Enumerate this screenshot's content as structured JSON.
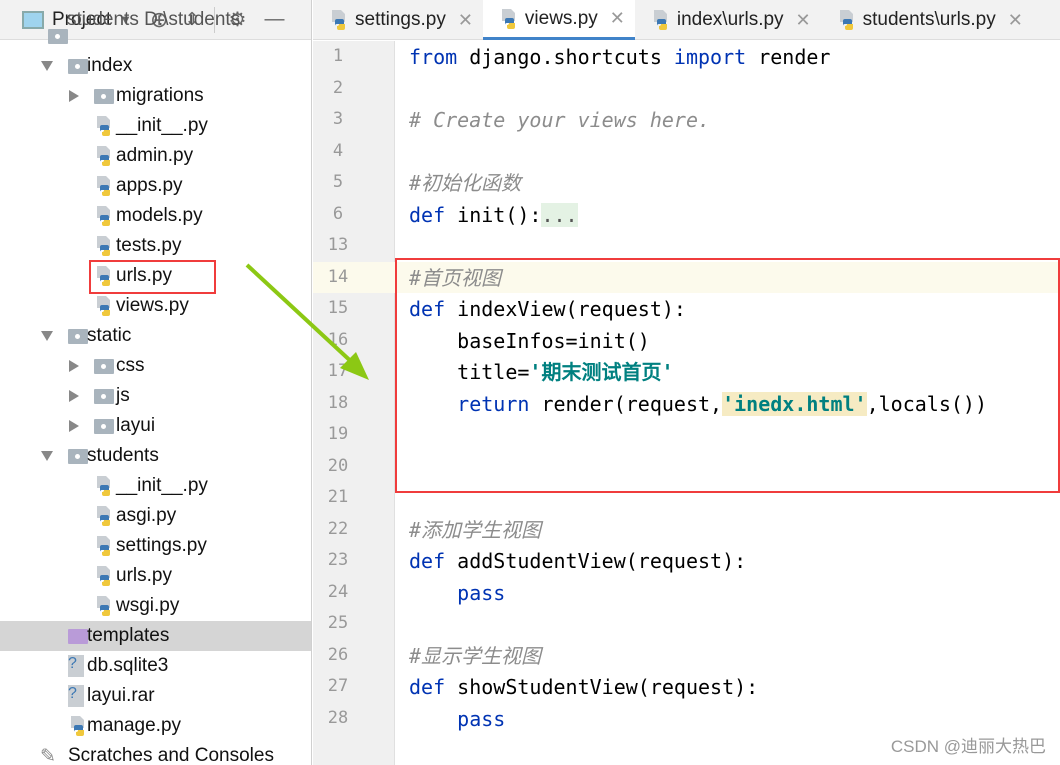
{
  "project_panel": {
    "title": "Project",
    "tree": [
      {
        "label": "students D:\\students",
        "level": 0,
        "type": "folder",
        "cut": true
      },
      {
        "label": "index",
        "level": 1,
        "type": "folder",
        "expanded": true
      },
      {
        "label": "migrations",
        "level": 2,
        "type": "folder",
        "expanded": false
      },
      {
        "label": "__init__.py",
        "level": 2,
        "type": "py"
      },
      {
        "label": "admin.py",
        "level": 2,
        "type": "py"
      },
      {
        "label": "apps.py",
        "level": 2,
        "type": "py"
      },
      {
        "label": "models.py",
        "level": 2,
        "type": "py"
      },
      {
        "label": "tests.py",
        "level": 2,
        "type": "py"
      },
      {
        "label": "urls.py",
        "level": 2,
        "type": "py",
        "boxed": true
      },
      {
        "label": "views.py",
        "level": 2,
        "type": "py"
      },
      {
        "label": "static",
        "level": 1,
        "type": "folder",
        "expanded": true
      },
      {
        "label": "css",
        "level": 2,
        "type": "folder",
        "expanded": false
      },
      {
        "label": "js",
        "level": 2,
        "type": "folder",
        "expanded": false
      },
      {
        "label": "layui",
        "level": 2,
        "type": "folder",
        "expanded": false
      },
      {
        "label": "students",
        "level": 1,
        "type": "folder",
        "expanded": true
      },
      {
        "label": "__init__.py",
        "level": 2,
        "type": "py"
      },
      {
        "label": "asgi.py",
        "level": 2,
        "type": "py"
      },
      {
        "label": "settings.py",
        "level": 2,
        "type": "py"
      },
      {
        "label": "urls.py",
        "level": 2,
        "type": "py"
      },
      {
        "label": "wsgi.py",
        "level": 2,
        "type": "py"
      },
      {
        "label": "templates",
        "level": 1,
        "type": "folder-purple",
        "selected": true
      },
      {
        "label": "db.sqlite3",
        "level": 1,
        "type": "file"
      },
      {
        "label": "layui.rar",
        "level": 1,
        "type": "file"
      },
      {
        "label": "manage.py",
        "level": 1,
        "type": "py"
      },
      {
        "label": "Scratches and Consoles",
        "level": 0,
        "type": "scratch"
      }
    ]
  },
  "tabs": [
    {
      "label": "settings.py"
    },
    {
      "label": "views.py",
      "active": true
    },
    {
      "label": "index\\urls.py"
    },
    {
      "label": "students\\urls.py"
    }
  ],
  "editor": {
    "lines": [
      {
        "n": "1",
        "tokens": [
          [
            "kw",
            "from"
          ],
          [
            "",
            "  django.shortcuts "
          ],
          [
            "kw",
            "import"
          ],
          [
            "",
            " render"
          ]
        ]
      },
      {
        "n": "2",
        "tokens": []
      },
      {
        "n": "3",
        "tokens": [
          [
            "cm",
            "# Create your views here."
          ]
        ]
      },
      {
        "n": "4",
        "tokens": []
      },
      {
        "n": "5",
        "tokens": [
          [
            "cm",
            "#初始化函数"
          ]
        ]
      },
      {
        "n": "6",
        "tokens": [
          [
            "kw",
            "def"
          ],
          [
            "",
            " init():"
          ],
          [
            "dots",
            "..."
          ]
        ]
      },
      {
        "n": "13",
        "tokens": []
      },
      {
        "n": "14",
        "tokens": [
          [
            "cm",
            "#首页视图"
          ]
        ]
      },
      {
        "n": "15",
        "tokens": [
          [
            "kw",
            "def"
          ],
          [
            "",
            " indexView(request):"
          ]
        ]
      },
      {
        "n": "16",
        "tokens": [
          [
            "",
            "    baseInfos=init()"
          ]
        ]
      },
      {
        "n": "17",
        "tokens": [
          [
            "",
            "    title="
          ],
          [
            "str",
            "'期末测试首页'"
          ]
        ]
      },
      {
        "n": "18",
        "tokens": [
          [
            "",
            "    "
          ],
          [
            "kw",
            "return"
          ],
          [
            "",
            " render(request,"
          ],
          [
            "str hl",
            "'inedx.html'"
          ],
          [
            "",
            ",locals())"
          ]
        ]
      },
      {
        "n": "19",
        "tokens": []
      },
      {
        "n": "20",
        "tokens": []
      },
      {
        "n": "21",
        "tokens": []
      },
      {
        "n": "22",
        "tokens": [
          [
            "cm",
            "#添加学生视图"
          ]
        ]
      },
      {
        "n": "23",
        "tokens": [
          [
            "kw",
            "def"
          ],
          [
            "",
            " addStudentView(request):"
          ]
        ]
      },
      {
        "n": "24",
        "tokens": [
          [
            "",
            "    "
          ],
          [
            "kw",
            "pass"
          ]
        ]
      },
      {
        "n": "25",
        "tokens": []
      },
      {
        "n": "26",
        "tokens": [
          [
            "cm",
            "#显示学生视图"
          ]
        ]
      },
      {
        "n": "27",
        "tokens": [
          [
            "kw",
            "def"
          ],
          [
            "",
            " showStudentView(request):"
          ]
        ]
      },
      {
        "n": "28",
        "tokens": [
          [
            "",
            "    "
          ],
          [
            "kw",
            "pass"
          ]
        ]
      }
    ],
    "current_line": "14"
  },
  "watermark": "CSDN @迪丽大热巴",
  "colors": {
    "annotation_box": "#f03c3c",
    "arrow": "#8cc814",
    "tab_underline": "#4083c9"
  }
}
